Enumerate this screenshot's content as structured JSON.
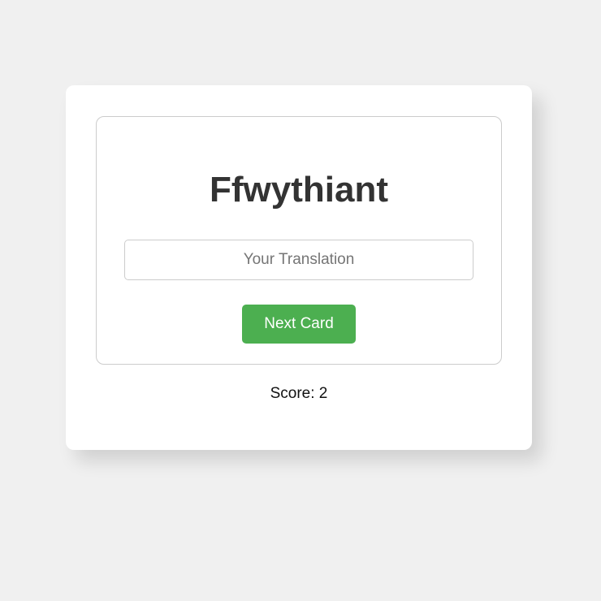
{
  "flashcard": {
    "word": "Ffwythiant",
    "input_placeholder": "Your Translation",
    "input_value": "",
    "next_button_label": "Next Card"
  },
  "score": {
    "label": "Score: 2",
    "value": 2
  },
  "colors": {
    "background": "#f0f0f0",
    "card": "#ffffff",
    "accent": "#4caf50",
    "border": "#cccccc",
    "text": "#333333"
  }
}
